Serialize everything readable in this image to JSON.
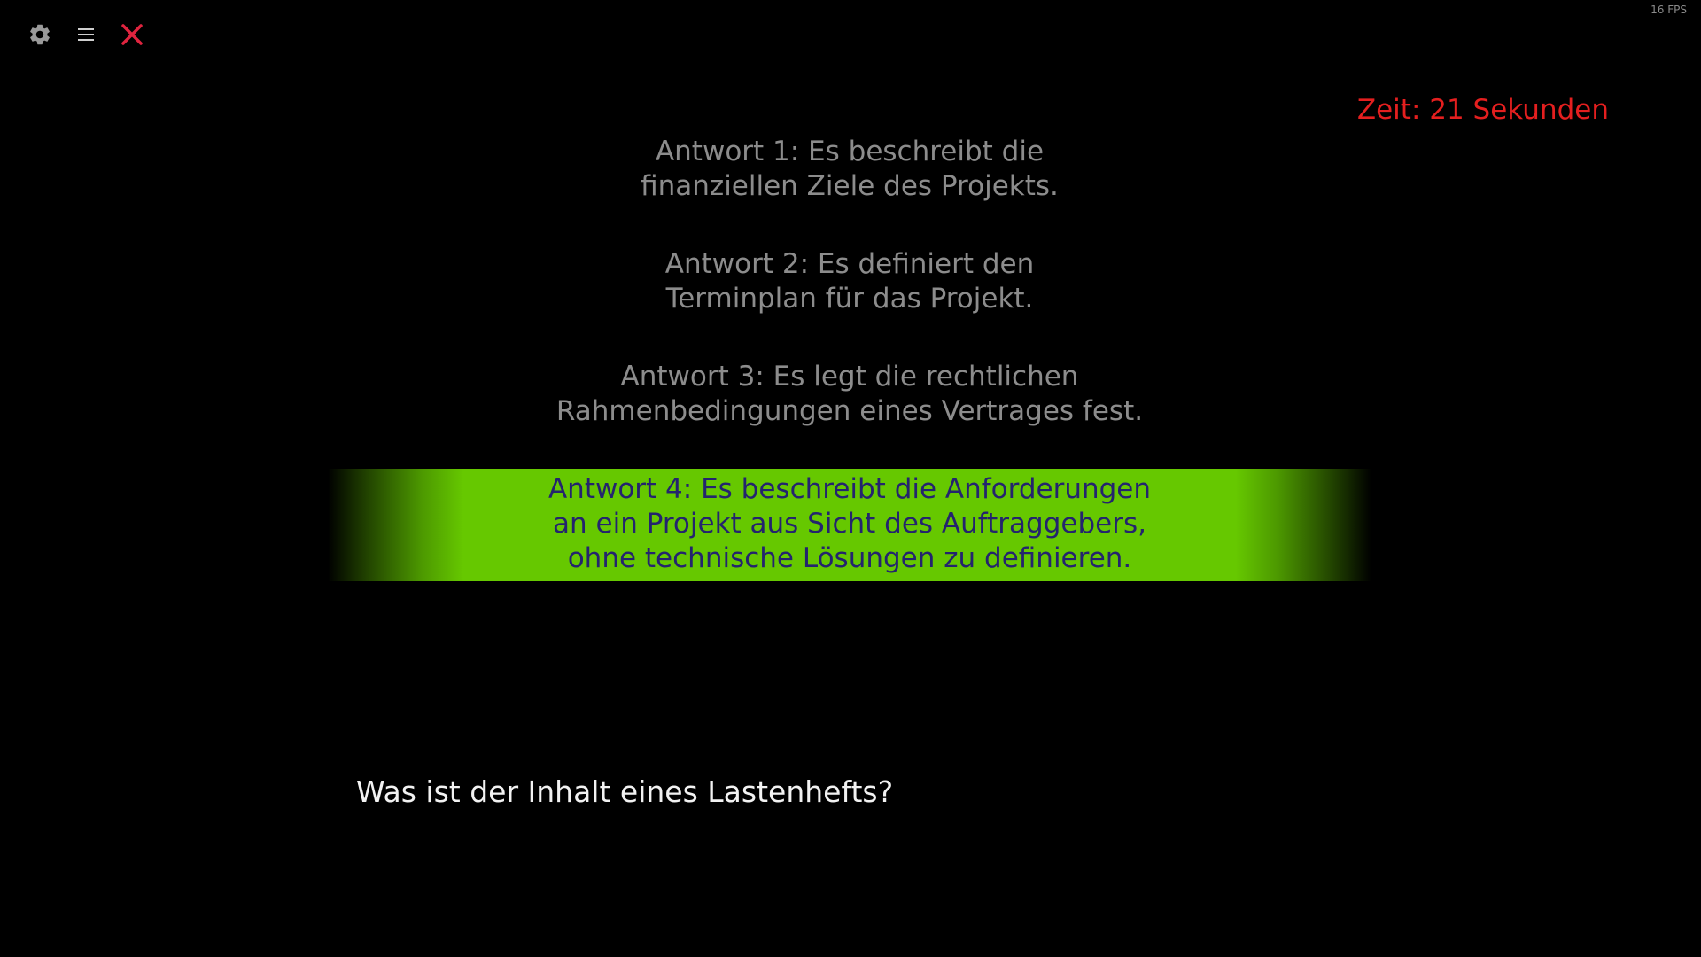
{
  "toolbar": {
    "settings_icon": "gear-icon",
    "menu_icon": "hamburger-icon",
    "close_icon": "close-icon",
    "close_color": "#e0243f",
    "icon_color": "#9a9a9a"
  },
  "status": {
    "fps": "16 FPS"
  },
  "timer": {
    "text": "Zeit: 21 Sekunden",
    "color": "#e41f1f"
  },
  "answers": [
    {
      "text": "Antwort 1: Es beschreibt die\nfinanziellen Ziele des Projekts.",
      "selected": false
    },
    {
      "text": "Antwort 2: Es definiert den\nTerminplan für das Projekt.",
      "selected": false
    },
    {
      "text": "Antwort 3: Es legt die rechtlichen\nRahmenbedingungen eines Vertrages fest.",
      "selected": false
    },
    {
      "text": "Antwort 4: Es beschreibt die Anforderungen\nan ein Projekt aus Sicht des Auftraggebers,\nohne technische Lösungen zu definieren.",
      "selected": true
    }
  ],
  "colors": {
    "background": "#000000",
    "answer_text": "#8c8c8c",
    "selected_bar": "#66c800",
    "selected_text": "#24246e",
    "question_text": "#f2f2f2"
  },
  "question": {
    "text": "Was ist der Inhalt eines Lastenhefts?"
  }
}
